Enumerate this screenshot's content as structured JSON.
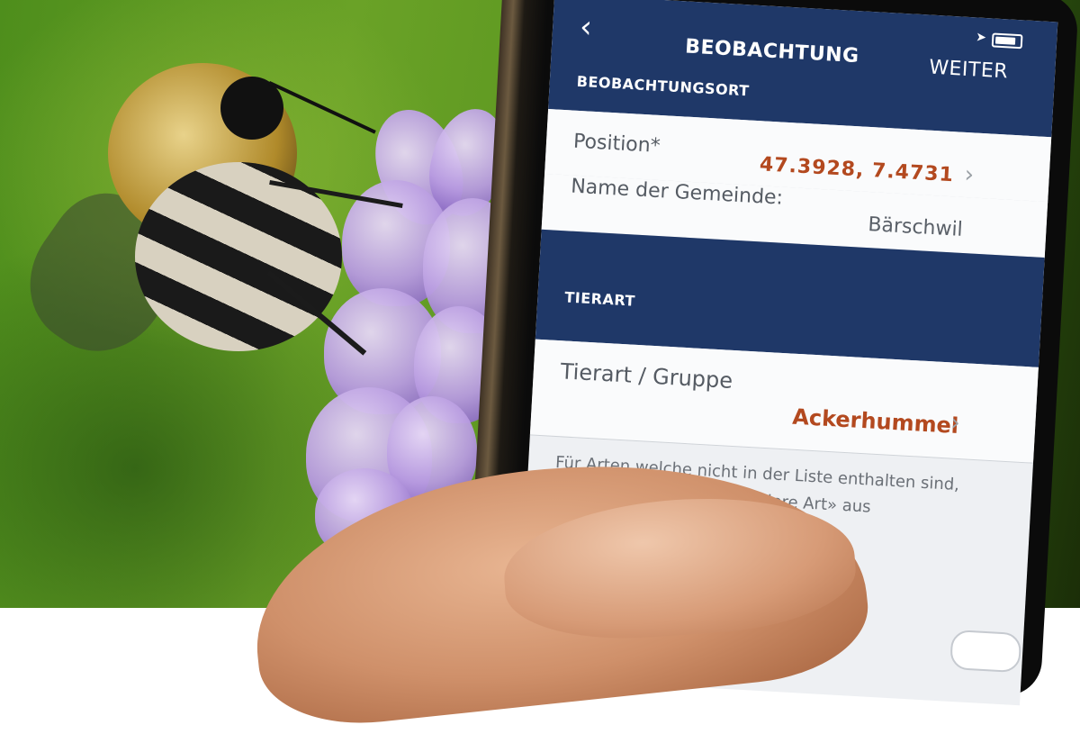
{
  "navbar": {
    "back_icon": "chevron-left-icon",
    "title": "BEOBACHTUNG",
    "next_label": "WEITER",
    "status_icons": [
      "location-arrow-icon",
      "battery-icon"
    ]
  },
  "section_location": {
    "header": "BEOBACHTUNGSORT",
    "position_label": "Position*",
    "position_value": "47.3928, 7.4731",
    "municipality_label": "Name der Gemeinde:",
    "municipality_value": "Bärschwil"
  },
  "section_species": {
    "header": "TIERART",
    "species_label": "Tierart / Gruppe",
    "species_value": "Ackerhummel",
    "hint": "Für Arten welche nicht in der Liste enthalten sind, wählen Sie unterhalb «Andere Art» aus"
  },
  "colors": {
    "navbar": "#1f3868",
    "value_accent": "#b3491f",
    "screen_bg": "#eef0f3"
  }
}
